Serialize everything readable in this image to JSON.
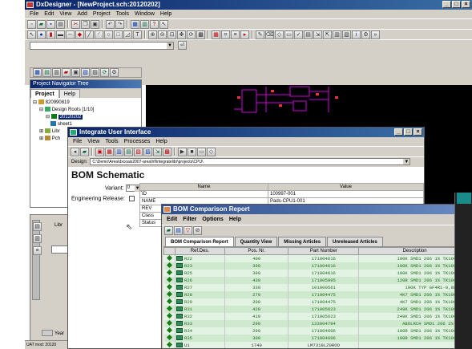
{
  "main": {
    "title": "DxDesigner - [NewProject.sch:20120202]",
    "menu": [
      "File",
      "Edit",
      "View",
      "Add",
      "Project",
      "Tools",
      "Window",
      "Help"
    ]
  },
  "navigator": {
    "title": "Project Navigator Tree",
    "tabs": [
      "Project",
      "Help"
    ],
    "tree": [
      "820990819",
      "Design Roots [1/10]",
      "20120202",
      "sheet1",
      "Libr",
      "Pch"
    ]
  },
  "left_panel": {
    "label1": "Libr",
    "label2": "Year",
    "status": "UAT mod: 20120"
  },
  "integrate": {
    "title": "Integrate User Interface",
    "menu": [
      "File",
      "View",
      "Tools",
      "Processes",
      "Help"
    ],
    "design_label": "Design:",
    "design_path": "C:\\Demo\\Area\\dxcoais2007-area\\hf\\integratelibr\\projects\\CPU\\",
    "heading": "BOM Schematic",
    "variant_label": "Variant:",
    "variant_value": "0",
    "release_label": "Engineering Release:",
    "prop_headers": [
      "Name",
      "Value"
    ],
    "props": [
      {
        "name": "ID",
        "value": "100997-001"
      },
      {
        "name": "NAME",
        "value": "Pads-CPU1-001"
      },
      {
        "name": "REV",
        "value": ""
      },
      {
        "name": "Class",
        "value": ""
      },
      {
        "name": "Status",
        "value": ""
      }
    ]
  },
  "bom": {
    "title": "BOM Comparison Report",
    "menu": [
      "Edit",
      "Filter",
      "Options",
      "Help"
    ],
    "tabs": [
      "BOM Comparison Report",
      "Quantity View",
      "Missing Articles",
      "Unreleased Articles"
    ],
    "columns": [
      "",
      "Ref.Des.",
      "Pos. Nr.",
      "Part Number",
      "Description"
    ],
    "rows": [
      {
        "ref": "R22",
        "pos": "400",
        "part": "171004616",
        "desc": "100K SMD1 206 1% TK100 ROOT"
      },
      {
        "ref": "R23",
        "pos": "390",
        "part": "171004616",
        "desc": "100K SMD1 206 1% TK100 ROOT"
      },
      {
        "ref": "R25",
        "pos": "390",
        "part": "171004616",
        "desc": "100K SMD1 206 1% TK100 ROOT"
      },
      {
        "ref": "R26",
        "pos": "430",
        "part": "171005995",
        "desc": "120R SMD1 206 1% TK100 ROOT"
      },
      {
        "ref": "R27",
        "pos": "330",
        "part": "101000561",
        "desc": "100K TYP GF4R1-0,8W 0,1%"
      },
      {
        "ref": "R28",
        "pos": "270",
        "part": "171004475",
        "desc": "4K7 SMD1 206 1% TK100 ROOT"
      },
      {
        "ref": "R29",
        "pos": "200",
        "part": "171004475",
        "desc": "4K7 SMD1 206 1% TK100 ROOT"
      },
      {
        "ref": "R31",
        "pos": "420",
        "part": "171005623",
        "desc": "249K SMD1 206 1% TK100 ROOT"
      },
      {
        "ref": "R32",
        "pos": "410",
        "part": "171005623",
        "desc": "249K SMD1 206 1% TK100 ROOT"
      },
      {
        "ref": "R33",
        "pos": "290",
        "part": "133004794",
        "desc": "ABOLRCH SMD1 206 1% TK100"
      },
      {
        "ref": "R34",
        "pos": "290",
        "part": "171004606",
        "desc": "100R SMD1 206 1% TK100 ROOT"
      },
      {
        "ref": "R35",
        "pos": "300",
        "part": "171004606",
        "desc": "100R SMD1 206 1% TK100 ROOT"
      },
      {
        "ref": "U1",
        "pos": "1740",
        "part": "LM7318LZ0ROO",
        "desc": ""
      }
    ]
  }
}
